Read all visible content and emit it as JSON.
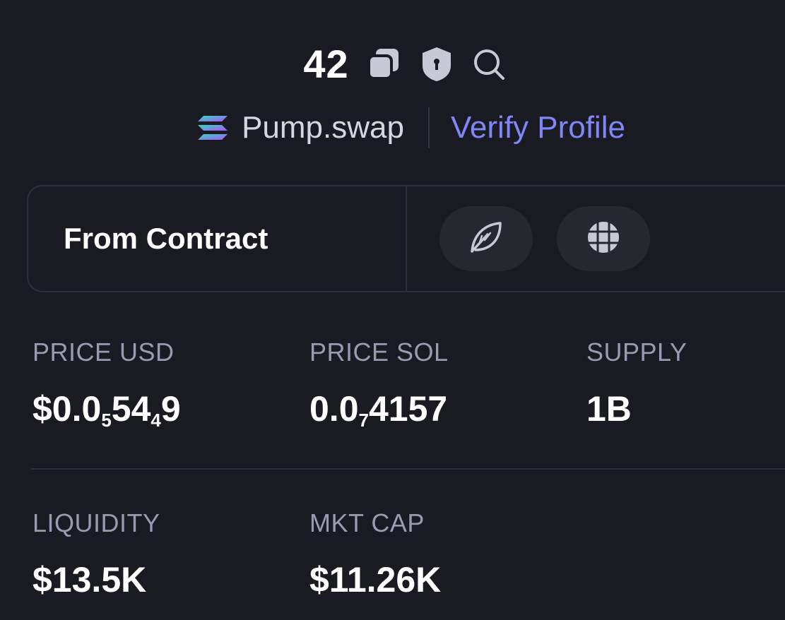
{
  "token": {
    "name": "42",
    "dex_name": "Pump.swap",
    "verify_label": "Verify Profile"
  },
  "contract": {
    "label": "From Contract"
  },
  "stats": {
    "price_usd": {
      "label": "PRICE USD",
      "value_prefix": "$0.0",
      "value_sub1": "5",
      "value_mid": "54",
      "value_sub2": "4",
      "value_suffix": "9"
    },
    "price_sol": {
      "label": "PRICE SOL",
      "value_prefix": "0.0",
      "value_sub": "7",
      "value_suffix": "4157"
    },
    "supply": {
      "label": "SUPPLY",
      "value": "1B"
    },
    "liquidity": {
      "label": "LIQUIDITY",
      "value": "$13.5K"
    },
    "mkt_cap": {
      "label": "MKT CAP",
      "value": "$11.26K"
    }
  },
  "colors": {
    "background": "#1a1a22",
    "accent_link": "#7f86f5",
    "label_gray": "#9a9ab0",
    "border": "#2f2f39"
  },
  "icons": {
    "copy": "copy-icon",
    "shield": "shield-icon",
    "search": "search-icon",
    "dex_logo": "solana-logo-icon",
    "leaf": "leaf-icon",
    "globe": "globe-icon"
  }
}
